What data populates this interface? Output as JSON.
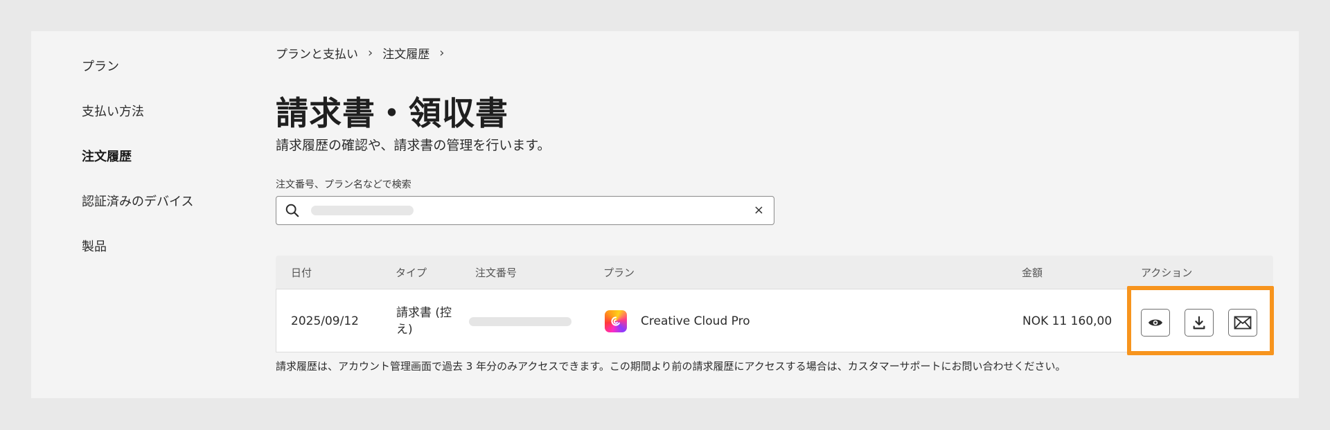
{
  "sidebar": {
    "items": [
      {
        "label": "プラン"
      },
      {
        "label": "支払い方法"
      },
      {
        "label": "注文履歴"
      },
      {
        "label": "認証済みのデバイス"
      },
      {
        "label": "製品"
      }
    ]
  },
  "breadcrumb": {
    "items": [
      "プランと支払い",
      "注文履歴"
    ],
    "separator": "›"
  },
  "page": {
    "title": "請求書・領収書",
    "description": "請求履歴の確認や、請求書の管理を行います。"
  },
  "search": {
    "label": "注文番号、プラン名などで検索",
    "value": "",
    "clear_glyph": "×"
  },
  "table": {
    "columns": [
      "日付",
      "タイプ",
      "注文番号",
      "プラン",
      "金額",
      "アクション"
    ],
    "rows": [
      {
        "date": "2025/09/12",
        "type_line1": "請求書 (控",
        "type_line2": "え)",
        "order_number": "",
        "plan": "Creative Cloud Pro",
        "amount": "NOK 11 160,00"
      }
    ]
  },
  "footnote": "請求履歴は、アカウント管理画面で過去 3 年分のみアクセスできます。この期間より前の請求履歴にアクセスする場合は、カスタマーサポートにお問い合わせください。",
  "icons": {
    "view": "eye-icon",
    "download": "download-icon",
    "email": "envelope-icon",
    "search": "search-icon",
    "plan": "creative-cloud-icon"
  },
  "colors": {
    "highlight": "#f7941d",
    "panel": "#f4f4f4",
    "background": "#e9e9e9"
  }
}
